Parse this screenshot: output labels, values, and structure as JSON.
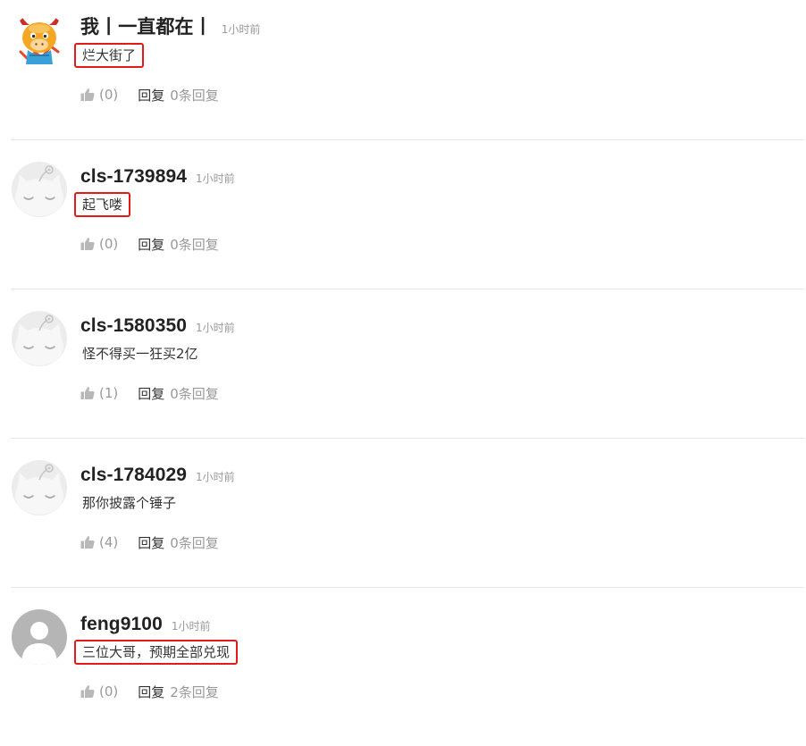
{
  "comments": [
    {
      "username": "我丨一直都在丨",
      "time": "1小时前",
      "content": "烂大街了",
      "highlighted": true,
      "avatar": "cartoon-ox-avatar",
      "like_count": "(0)",
      "reply_label": "回复",
      "reply_count": "0条回复"
    },
    {
      "username": "cls-1739894",
      "time": "1小时前",
      "content": "起飞喽",
      "highlighted": true,
      "avatar": "cat-robot-default-avatar",
      "like_count": "(0)",
      "reply_label": "回复",
      "reply_count": "0条回复"
    },
    {
      "username": "cls-1580350",
      "time": "1小时前",
      "content": "怪不得买一狂买2亿",
      "highlighted": false,
      "avatar": "cat-robot-default-avatar",
      "like_count": "(1)",
      "reply_label": "回复",
      "reply_count": "0条回复"
    },
    {
      "username": "cls-1784029",
      "time": "1小时前",
      "content": "那你披露个锤子",
      "highlighted": false,
      "avatar": "cat-robot-default-avatar",
      "like_count": "(4)",
      "reply_label": "回复",
      "reply_count": "0条回复"
    },
    {
      "username": "feng9100",
      "time": "1小时前",
      "content": "三位大哥，预期全部兑现",
      "highlighted": true,
      "avatar": "person-silhouette-avatar",
      "like_count": "(0)",
      "reply_label": "回复",
      "reply_count": "2条回复"
    }
  ],
  "colors": {
    "highlight_border": "#e21a1a",
    "username": "#222222",
    "muted": "#999999",
    "divider": "#e6e6e6"
  }
}
